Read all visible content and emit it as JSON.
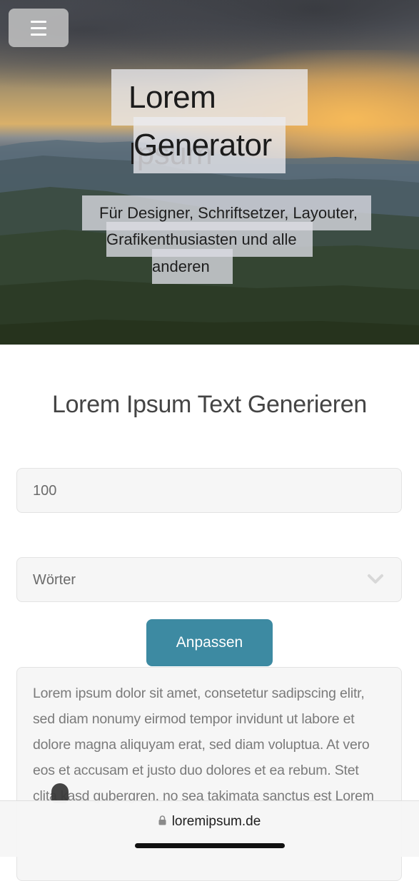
{
  "hero": {
    "menu_icon": "hamburger-menu-icon",
    "title_lines": [
      "Lorem Ipsum",
      "Generator"
    ],
    "subtitle_lines": [
      "Für Designer, Schriftsetzer, Layouter,",
      "Grafikenthusiasten und alle",
      "anderen"
    ]
  },
  "generator": {
    "heading": "Lorem Ipsum Text Generieren",
    "count_value": "100",
    "unit_value": "Wörter",
    "unit_icon": "chevron-down-icon",
    "apply_label": "Anpassen",
    "output_text": "Lorem ipsum dolor sit amet, consetetur sadipscing elitr, sed diam nonumy eirmod tempor invidunt ut labore et dolore magna aliquyam erat, sed diam voluptua. At vero eos et accusam et justo duo dolores et ea rebum. Stet clita kasd gubergren, no sea takimata sanctus est Lorem"
  },
  "browser": {
    "lock_icon": "lock-icon",
    "url": "loremipsum.de"
  },
  "colors": {
    "accent": "#3d8aa2",
    "field_bg": "#f6f6f6",
    "text_muted": "#7a7a7a"
  }
}
